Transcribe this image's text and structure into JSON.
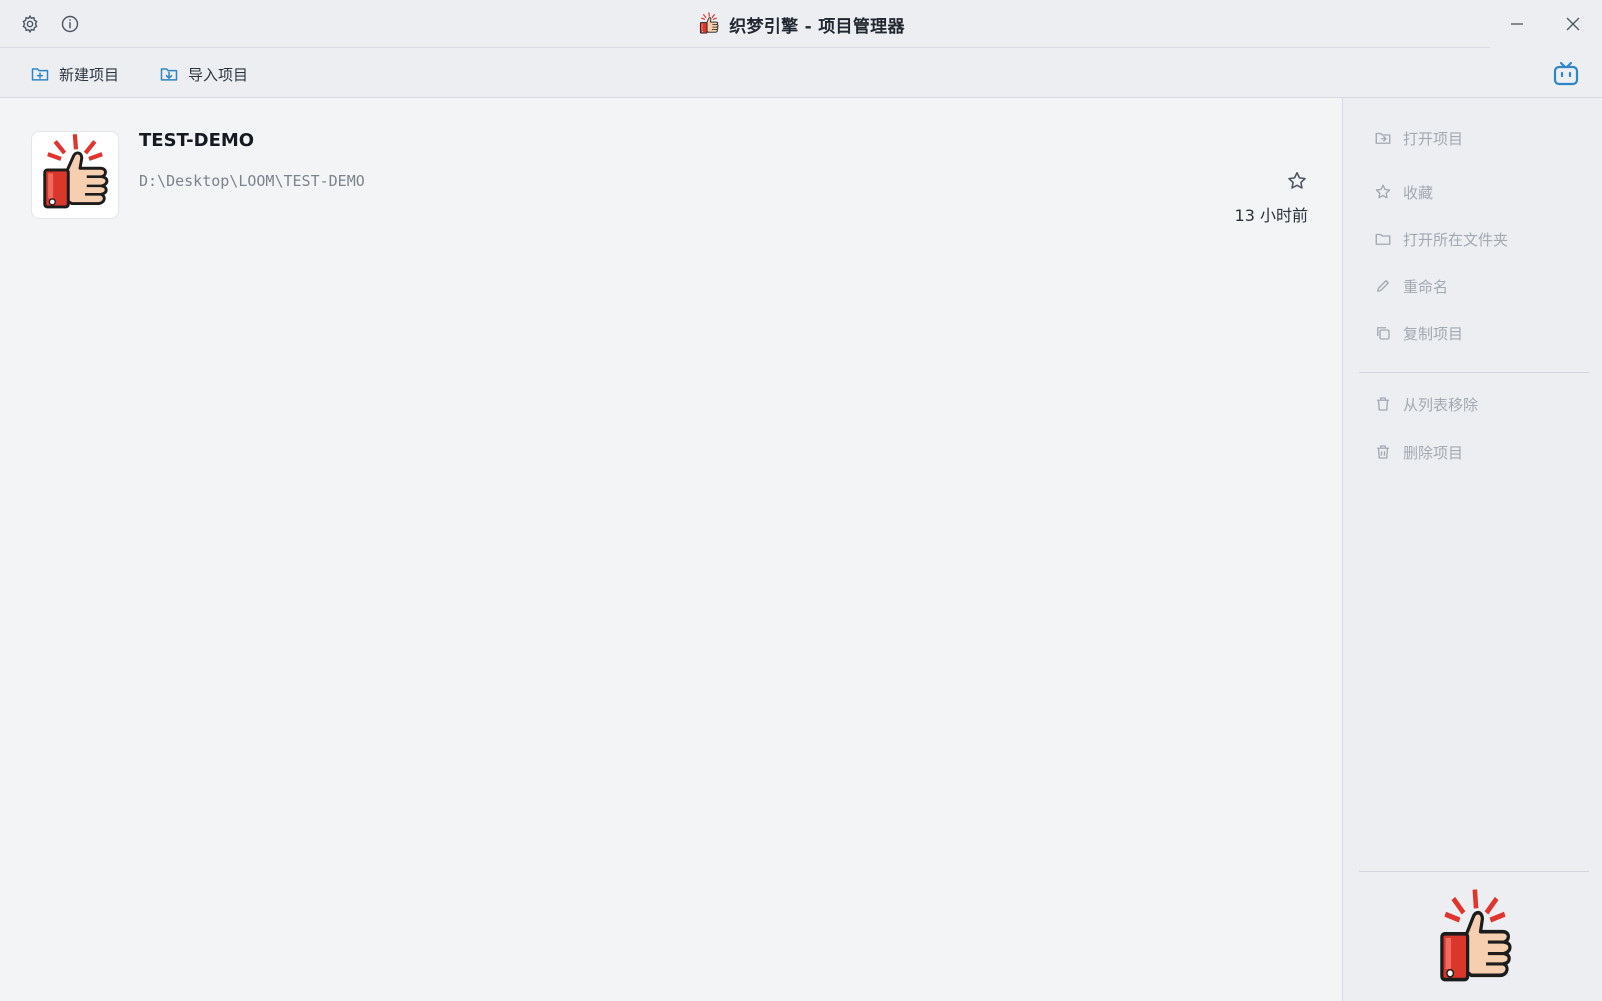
{
  "window": {
    "title": "织梦引擎 - 项目管理器",
    "buttons": [
      "settings-icon",
      "info-icon",
      "minimize-icon",
      "close-icon"
    ]
  },
  "toolbar": {
    "new_project_label": "新建项目",
    "import_project_label": "导入项目",
    "right_icon": "bilibili-tv-icon"
  },
  "projects": [
    {
      "name": "TEST-DEMO",
      "path": "D:\\Desktop\\LOOM\\TEST-DEMO",
      "time": "13 小时前",
      "favorited": false,
      "thumbnail_icon": "thumbs-up-icon"
    }
  ],
  "side_menu": {
    "items": [
      {
        "label": "打开项目",
        "icon": "folder-open-icon"
      },
      {
        "label": "收藏",
        "icon": "star-icon"
      },
      {
        "label": "打开所在文件夹",
        "icon": "folder-icon"
      },
      {
        "label": "重命名",
        "icon": "pencil-icon"
      },
      {
        "label": "复制项目",
        "icon": "copy-icon"
      },
      {
        "label": "从列表移除",
        "icon": "trash-icon"
      },
      {
        "label": "删除项目",
        "icon": "trash-icon"
      }
    ]
  },
  "colors": {
    "accent": "#2f86c4",
    "background": "#f3f4f6",
    "toolbar": "#eceef2",
    "disabled_text": "#a3a9b2",
    "thumb_red": "#d9362c",
    "thumb_skin": "#f5c8a8"
  }
}
